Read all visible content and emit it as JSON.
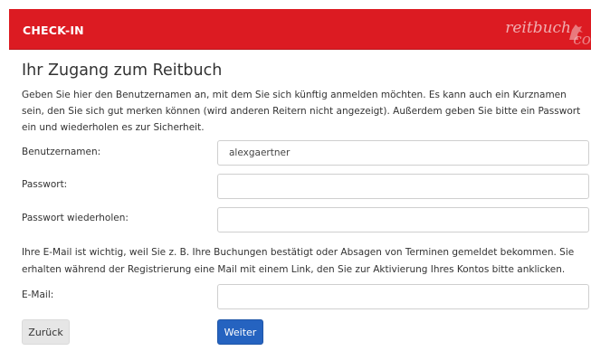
{
  "header": {
    "title": "CHECK-IN",
    "logo_main": "reitbuch",
    "logo_tail": "co"
  },
  "page_title": "Ihr Zugang zum Reitbuch",
  "intro_text": "Geben Sie hier den Benutzernamen an, mit dem Sie sich künftig anmelden möchten. Es kann auch ein Kurznamen sein, den Sie sich gut merken können (wird anderen Reitern nicht angezeigt). Außerdem geben Sie bitte ein Passwort ein und wiederholen es zur Sicherheit.",
  "form": {
    "username": {
      "label": "Benutzernamen:",
      "value": "alexgaertner"
    },
    "password": {
      "label": "Passwort:",
      "value": ""
    },
    "password_repeat": {
      "label": "Passwort wiederholen:",
      "value": ""
    },
    "email": {
      "label": "E-Mail:",
      "value": ""
    }
  },
  "email_info": "Ihre E-Mail ist wichtig, weil Sie z. B. Ihre Buchungen bestätigt oder Absagen von Terminen gemeldet bekommen. Sie erhalten während der Registrierung eine Mail mit einem Link, den Sie zur Aktivierung Ihres Kontos bitte anklicken.",
  "buttons": {
    "back": "Zurück",
    "next": "Weiter"
  },
  "colors": {
    "header_bg": "#dc1b22",
    "primary_button": "#2563c0"
  }
}
